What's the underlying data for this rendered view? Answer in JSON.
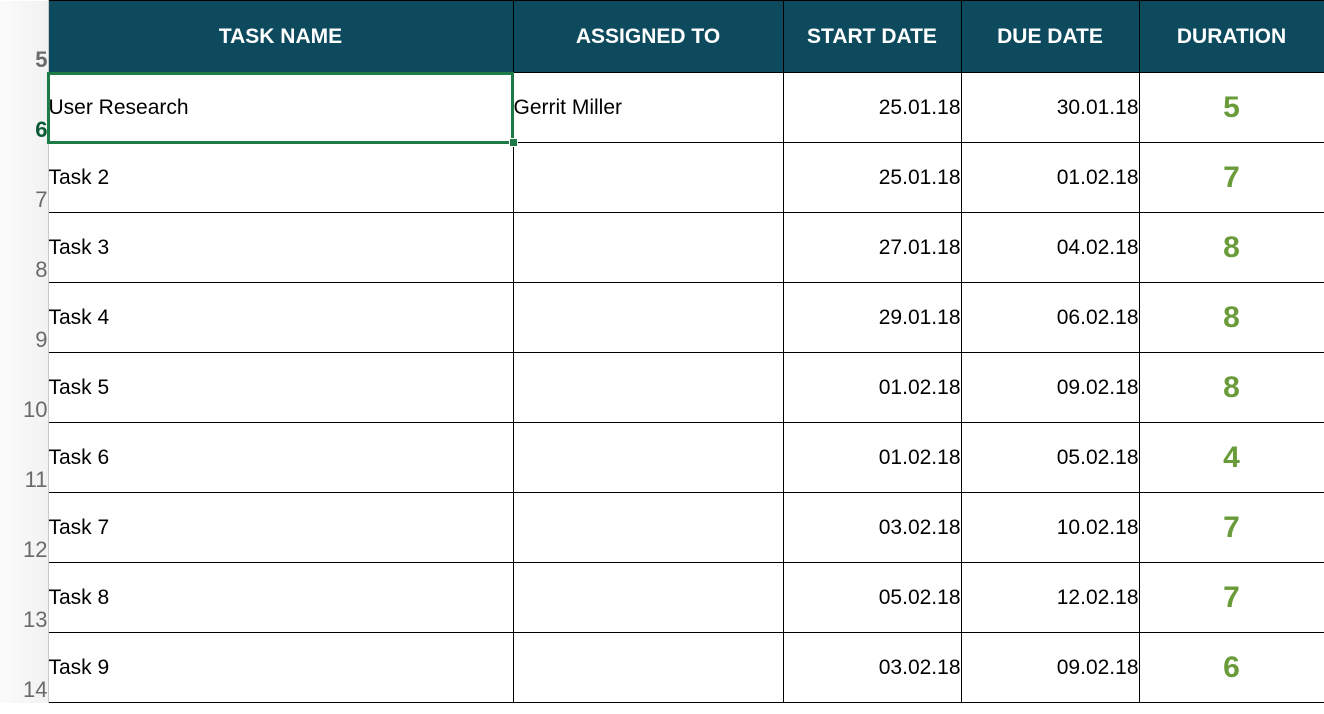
{
  "headers": {
    "task": "TASK NAME",
    "assigned": "ASSIGNED TO",
    "start": "START DATE",
    "due": "DUE DATE",
    "duration": "DURATION"
  },
  "header_row_number": "5",
  "rows": [
    {
      "num": "6",
      "task": "User Research",
      "assigned": "Gerrit Miller",
      "start": "25.01.18",
      "due": "30.01.18",
      "duration": "5",
      "selected": true
    },
    {
      "num": "7",
      "task": "Task 2",
      "assigned": "",
      "start": "25.01.18",
      "due": "01.02.18",
      "duration": "7"
    },
    {
      "num": "8",
      "task": "Task 3",
      "assigned": "",
      "start": "27.01.18",
      "due": "04.02.18",
      "duration": "8"
    },
    {
      "num": "9",
      "task": "Task 4",
      "assigned": "",
      "start": "29.01.18",
      "due": "06.02.18",
      "duration": "8"
    },
    {
      "num": "10",
      "task": "Task 5",
      "assigned": "",
      "start": "01.02.18",
      "due": "09.02.18",
      "duration": "8"
    },
    {
      "num": "11",
      "task": "Task 6",
      "assigned": "",
      "start": "01.02.18",
      "due": "05.02.18",
      "duration": "4"
    },
    {
      "num": "12",
      "task": "Task 7",
      "assigned": "",
      "start": "03.02.18",
      "due": "10.02.18",
      "duration": "7"
    },
    {
      "num": "13",
      "task": "Task 8",
      "assigned": "",
      "start": "05.02.18",
      "due": "12.02.18",
      "duration": "7"
    },
    {
      "num": "14",
      "task": "Task 9",
      "assigned": "",
      "start": "03.02.18",
      "due": "09.02.18",
      "duration": "6"
    }
  ],
  "colors": {
    "header_bg": "#0d4a5e",
    "duration_text": "#6a9b3a",
    "selection": "#1e7a46"
  }
}
